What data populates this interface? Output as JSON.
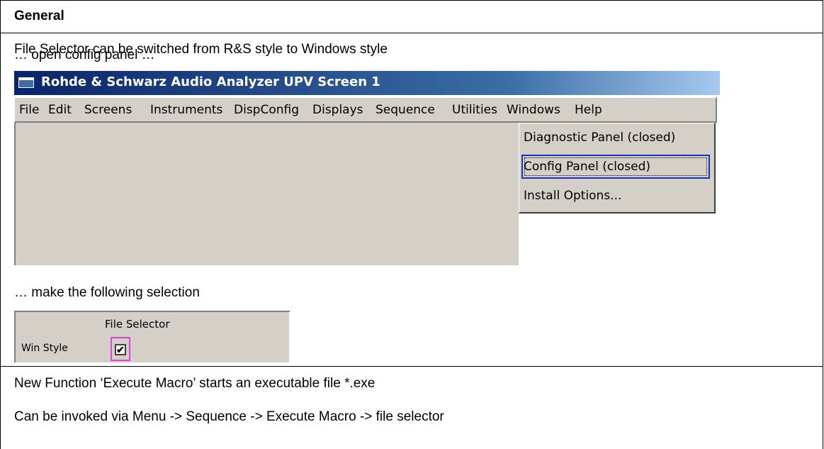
{
  "section": {
    "heading": "General",
    "line1": "File Selector can be switched from R&S style to Windows style",
    "line2": "… open config panel …",
    "line3": "… make the following selection",
    "line4": "New Function ‘Execute Macro’ starts an executable file *.exe",
    "line5": "Can be invoked via Menu -> Sequence -> Execute Macro -> file selector"
  },
  "screenshot1": {
    "window_title": "Rohde & Schwarz Audio Analyzer UPV Screen 1",
    "menu": [
      "File",
      "Edit",
      "Screens",
      "Instruments",
      "DispConfig",
      "Displays",
      "Sequence",
      "Utilities",
      "Windows",
      "Help"
    ],
    "dropdown": [
      "Diagnostic Panel (closed)",
      "Config Panel (closed)",
      "Install Options..."
    ],
    "focused_item": "Config Panel (closed)"
  },
  "screenshot2": {
    "group_title": "File Selector",
    "label": "Win Style",
    "checked": true,
    "check_glyph": "✔"
  }
}
